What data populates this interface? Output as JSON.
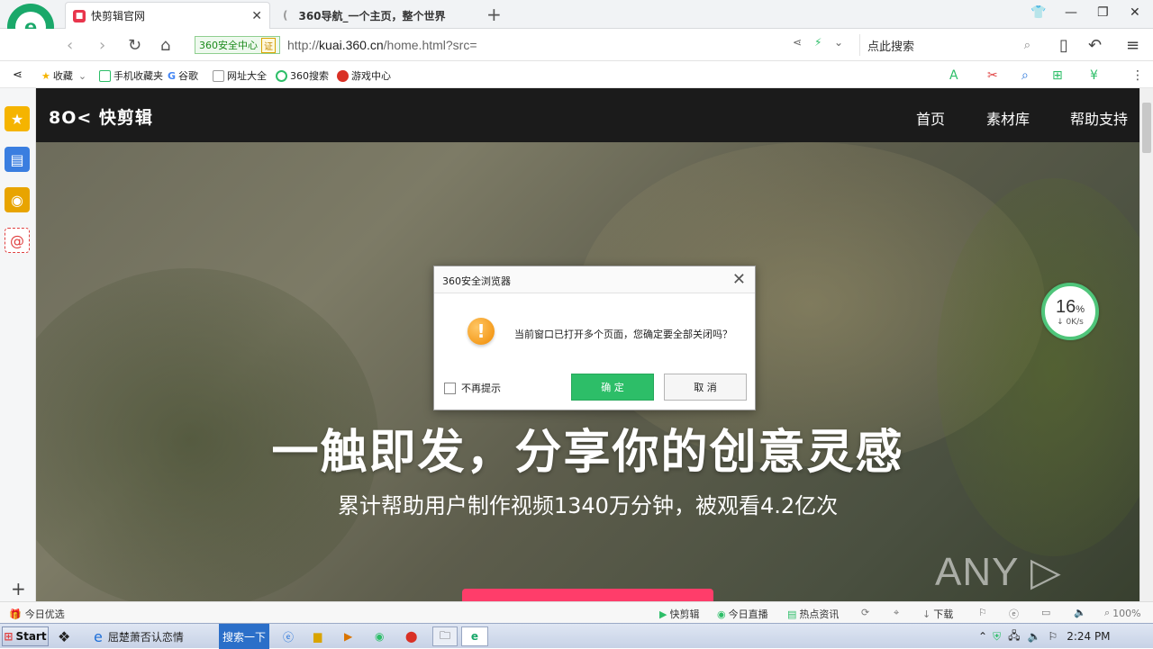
{
  "tabs": [
    {
      "title": "快剪辑官网",
      "active": true
    },
    {
      "title": "360导航_一个主页，整个世界",
      "active": false
    }
  ],
  "address": {
    "security_label": "360安全中心",
    "cert_label": "证",
    "url_prefix": "http://",
    "url_host": "kuai.360.cn",
    "url_rest": "/home.html?src=",
    "search_placeholder": "点此搜索"
  },
  "bookmarks": [
    "收藏",
    "手机收藏夹",
    "谷歌",
    "网址大全",
    "360搜索",
    "游戏中心"
  ],
  "site": {
    "logo": "8O< 快剪辑",
    "nav": [
      "首页",
      "素材库",
      "帮助支持"
    ],
    "headline": "一触即发，分享你的创意灵感",
    "subline": "累计帮助用户制作视频1340万分钟，被观看4.2亿次",
    "watermark": "ANY ▷ RUN"
  },
  "speed_widget": {
    "percent": "16",
    "percent_unit": "%",
    "rate": "↓ 0K/s"
  },
  "dialog": {
    "title": "360安全浏览器",
    "message": "当前窗口已打开多个页面，您确定要全部关闭吗？",
    "checkbox_label": "不再提示",
    "ok_label": "确 定",
    "cancel_label": "取 消"
  },
  "statusbar": {
    "left": "今日优选",
    "items": [
      "快剪辑",
      "今日直播",
      "热点资讯",
      "下载"
    ],
    "zoom": "100%"
  },
  "taskbar": {
    "start": "Start",
    "window_title": "屈楚萧否认恋情",
    "search_button": "搜索一下",
    "clock": "2:24 PM"
  },
  "colors": {
    "accent_green": "#2dbe68",
    "cta_pink": "#ff3d6a",
    "brand_green": "#1aa86a"
  }
}
